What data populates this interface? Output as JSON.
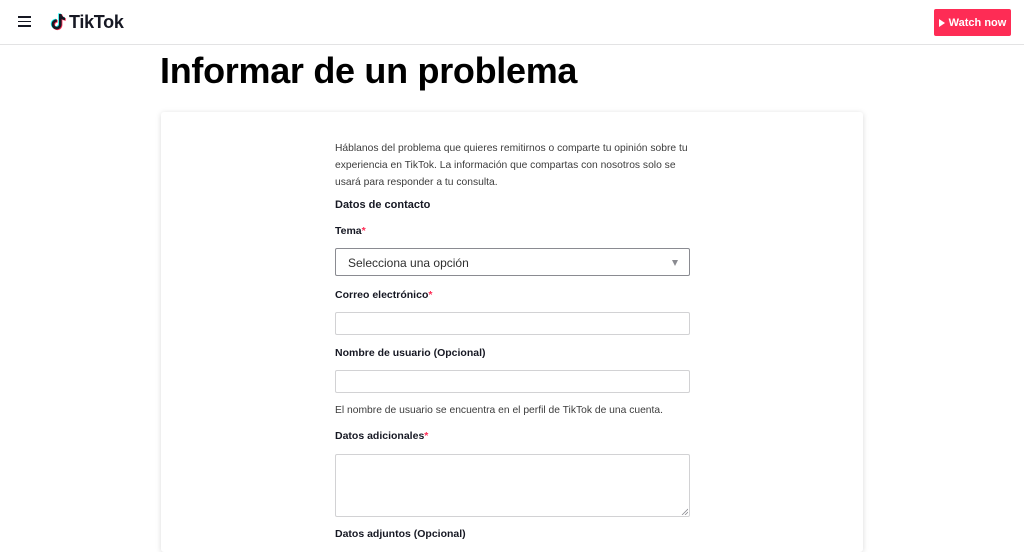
{
  "header": {
    "logo_text": "TikTok",
    "watch_button_label": "Watch now",
    "accent_color": "#fe2c55"
  },
  "page": {
    "title": "Informar de un problema"
  },
  "form": {
    "intro": "Háblanos del problema que quieres remitirnos o comparte tu opinión sobre tu experiencia en TikTok. La información que compartas con nosotros solo se usará para responder a tu consulta.",
    "section_title": "Datos de contacto",
    "topic": {
      "label": "Tema",
      "required_mark": "*",
      "selected": "Selecciona una opción"
    },
    "email": {
      "label": "Correo electrónico",
      "required_mark": "*",
      "value": ""
    },
    "username": {
      "label": "Nombre de usuario (Opcional)",
      "value": "",
      "helper": "El nombre de usuario se encuentra en el perfil de TikTok de una cuenta."
    },
    "additional": {
      "label": "Datos adicionales",
      "required_mark": "*",
      "value": ""
    },
    "attachments": {
      "label": "Datos adjuntos (Opcional)"
    }
  },
  "icons": {
    "menu": "hamburger-menu-icon",
    "logo": "tiktok-note-icon",
    "play": "play-icon",
    "dropdown": "caret-down-icon"
  }
}
